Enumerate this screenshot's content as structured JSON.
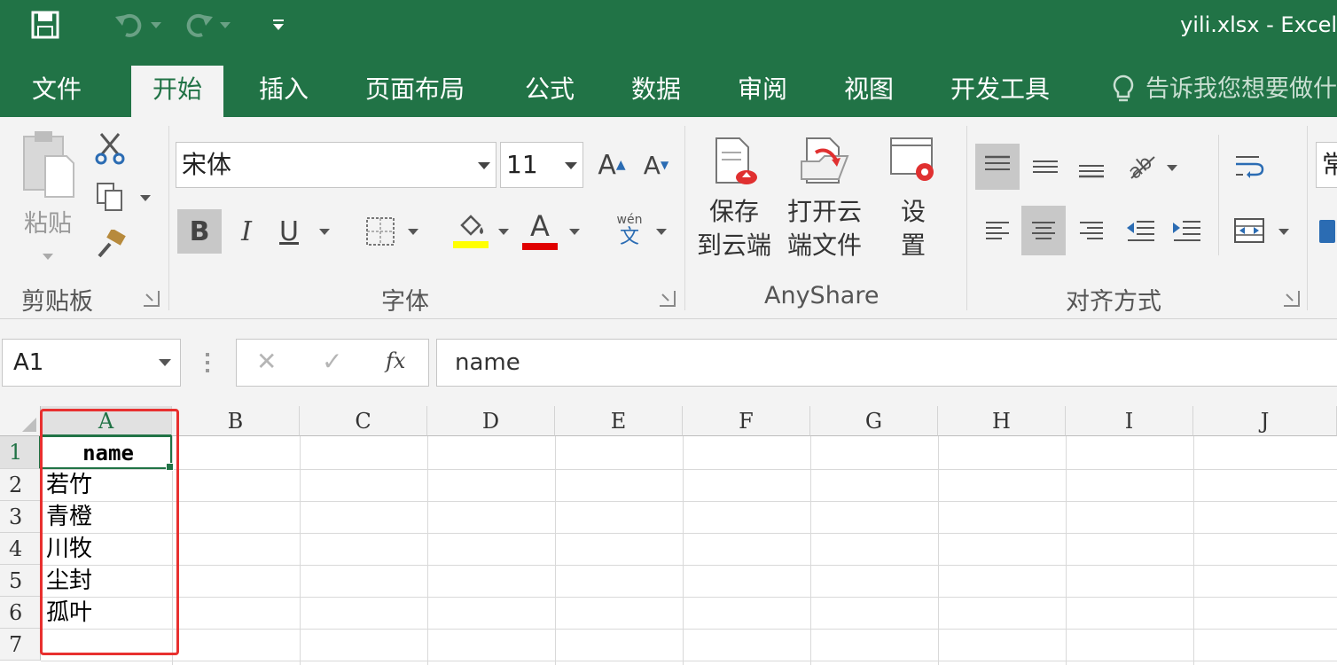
{
  "window": {
    "title": "yili.xlsx - Excel"
  },
  "qat": {
    "save_icon": "save-icon",
    "undo_icon": "undo-icon",
    "redo_icon": "redo-icon",
    "customize_icon": "customize-qat-icon"
  },
  "tabs": [
    {
      "label": "文件"
    },
    {
      "label": "开始"
    },
    {
      "label": "插入"
    },
    {
      "label": "页面布局"
    },
    {
      "label": "公式"
    },
    {
      "label": "数据"
    },
    {
      "label": "审阅"
    },
    {
      "label": "视图"
    },
    {
      "label": "开发工具"
    }
  ],
  "tell_me": {
    "placeholder": "告诉我您想要做什"
  },
  "ribbon": {
    "clipboard": {
      "label": "剪贴板",
      "paste_label": "粘贴"
    },
    "font": {
      "label": "字体",
      "font_name": "宋体",
      "font_size": "11",
      "bold": "B",
      "italic": "I",
      "underline": "U",
      "font_color_glyph": "A",
      "phonetic_top": "wén",
      "phonetic_bottom": "文",
      "grow": "A",
      "shrink": "A"
    },
    "anyshare": {
      "label": "AnyShare",
      "save_cloud": [
        "保存",
        "到云端"
      ],
      "open_cloud": [
        "打开云",
        "端文件"
      ],
      "settings": [
        "设",
        "置"
      ]
    },
    "alignment": {
      "label": "对齐方式"
    },
    "number": {
      "format_partial": "常"
    }
  },
  "formula_bar": {
    "name_box": "A1",
    "cancel": "✕",
    "enter": "✓",
    "fx": "fx",
    "value": "name"
  },
  "sheet": {
    "columns": [
      "A",
      "B",
      "C",
      "D",
      "E",
      "F",
      "G",
      "H",
      "I",
      "J"
    ],
    "rows": [
      "1",
      "2",
      "3",
      "4",
      "5",
      "6",
      "7"
    ],
    "cells": [
      "name",
      "若竹",
      "青橙",
      "川牧",
      "尘封",
      "孤叶",
      ""
    ]
  },
  "colors": {
    "excel_green": "#217346",
    "highlight_red": "#e8302f"
  }
}
